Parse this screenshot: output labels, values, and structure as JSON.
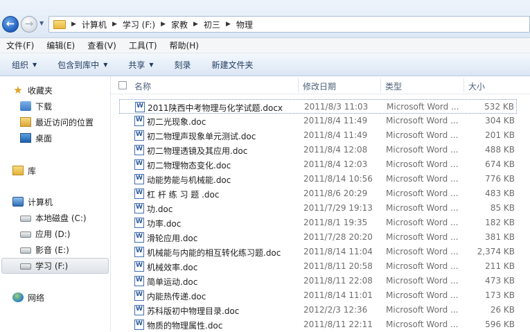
{
  "address": {
    "crumbs": [
      "计算机",
      "学习 (F:)",
      "家教",
      "初三",
      "物理"
    ]
  },
  "menu": [
    "文件(F)",
    "编辑(E)",
    "查看(V)",
    "工具(T)",
    "帮助(H)"
  ],
  "commands": [
    {
      "label": "组织",
      "dropdown": true
    },
    {
      "label": "包含到库中",
      "dropdown": true
    },
    {
      "label": "共享",
      "dropdown": true
    },
    {
      "label": "刻录",
      "dropdown": false
    },
    {
      "label": "新建文件夹",
      "dropdown": false
    }
  ],
  "nav": {
    "favorites": "收藏夹",
    "downloads": "下载",
    "recent": "最近访问的位置",
    "desktop": "桌面",
    "libraries": "库",
    "computer": "计算机",
    "drive_c": "本地磁盘 (C:)",
    "drive_d": "应用 (D:)",
    "drive_e": "影音 (E:)",
    "drive_f": "学习 (F:)",
    "network": "网络"
  },
  "columns": {
    "name": "名称",
    "date": "修改日期",
    "type": "类型",
    "size": "大小"
  },
  "files": [
    {
      "name": "2011陕西中考物理与化学试题.docx",
      "date": "2011/8/3 11:03",
      "type": "Microsoft Word ...",
      "size": "532 KB"
    },
    {
      "name": "初二光现象.doc",
      "date": "2011/8/4 11:49",
      "type": "Microsoft Word ...",
      "size": "304 KB"
    },
    {
      "name": "初二物理声现象单元测试.doc",
      "date": "2011/8/4 11:49",
      "type": "Microsoft Word ...",
      "size": "201 KB"
    },
    {
      "name": "初二物理透镜及其应用.doc",
      "date": "2011/8/4 12:08",
      "type": "Microsoft Word ...",
      "size": "488 KB"
    },
    {
      "name": "初二物理物态变化.doc",
      "date": "2011/8/4 12:03",
      "type": "Microsoft Word ...",
      "size": "674 KB"
    },
    {
      "name": "动能势能与机械能.doc",
      "date": "2011/8/14 10:56",
      "type": "Microsoft Word ...",
      "size": "776 KB"
    },
    {
      "name": "杠 杆 练 习 题 .doc",
      "date": "2011/8/6 20:29",
      "type": "Microsoft Word ...",
      "size": "483 KB"
    },
    {
      "name": "功.doc",
      "date": "2011/7/29 19:13",
      "type": "Microsoft Word ...",
      "size": "85 KB"
    },
    {
      "name": "功率.doc",
      "date": "2011/8/1 19:35",
      "type": "Microsoft Word ...",
      "size": "182 KB"
    },
    {
      "name": "滑轮应用.doc",
      "date": "2011/7/28 20:20",
      "type": "Microsoft Word ...",
      "size": "381 KB"
    },
    {
      "name": "机械能与内能的相互转化练习题.doc",
      "date": "2011/8/14 11:04",
      "type": "Microsoft Word ...",
      "size": "2,374 KB"
    },
    {
      "name": "机械效率.doc",
      "date": "2011/8/11 20:58",
      "type": "Microsoft Word ...",
      "size": "211 KB"
    },
    {
      "name": "简单运动.doc",
      "date": "2011/8/11 22:08",
      "type": "Microsoft Word ...",
      "size": "473 KB"
    },
    {
      "name": "内能热传递.doc",
      "date": "2011/8/14 11:01",
      "type": "Microsoft Word ...",
      "size": "173 KB"
    },
    {
      "name": "苏科版初中物理目录.doc",
      "date": "2012/2/3 12:36",
      "type": "Microsoft Word ...",
      "size": "26 KB"
    },
    {
      "name": "物质的物理属性.doc",
      "date": "2011/8/11 22:11",
      "type": "Microsoft Word ...",
      "size": "596 KB"
    }
  ]
}
